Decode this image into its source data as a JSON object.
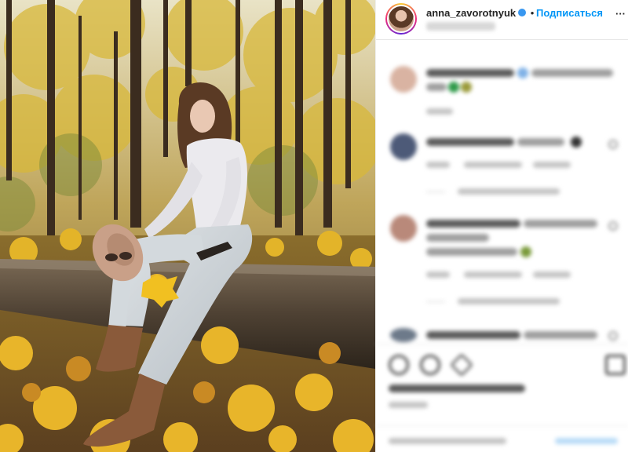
{
  "post": {
    "username": "anna_zavorotnyuk",
    "separator": "•",
    "subscribe_label": "Подписаться",
    "more_icon": "ellipsis-icon",
    "verified_icon": "verified-badge-icon"
  },
  "colors": {
    "accent": "#0095f6",
    "verified": "#3897f0",
    "text": "#262626"
  }
}
